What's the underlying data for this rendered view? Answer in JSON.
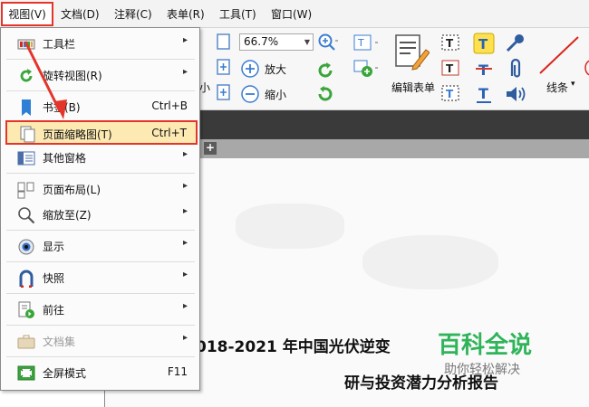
{
  "menubar": {
    "items": [
      "视图(V)",
      "文档(D)",
      "注释(C)",
      "表单(R)",
      "工具(T)",
      "窗口(W)"
    ]
  },
  "ribbon": {
    "zoom_value": "66.7%",
    "zoom_in_label": "放大",
    "zoom_out_label": "缩小",
    "edit_form_label": "编辑表单",
    "lines_label": "线条",
    "partial_label": "小"
  },
  "view_menu": {
    "items": [
      {
        "label": "工具栏",
        "shortcut": "",
        "submenu": true
      },
      {
        "label": "旋转视图(R)",
        "shortcut": "",
        "submenu": true
      },
      {
        "label": "书签(B)",
        "shortcut": "Ctrl+B",
        "submenu": false
      },
      {
        "label": "页面缩略图(T)",
        "shortcut": "Ctrl+T",
        "submenu": false
      },
      {
        "label": "其他窗格",
        "shortcut": "",
        "submenu": true
      },
      {
        "label": "页面布局(L)",
        "shortcut": "",
        "submenu": true
      },
      {
        "label": "缩放至(Z)",
        "shortcut": "",
        "submenu": true
      },
      {
        "label": "显示",
        "shortcut": "",
        "submenu": true
      },
      {
        "label": "快照",
        "shortcut": "",
        "submenu": true
      },
      {
        "label": "前往",
        "shortcut": "",
        "submenu": true
      },
      {
        "label": "文档集",
        "shortcut": "",
        "submenu": true
      },
      {
        "label": "全屏模式",
        "shortcut": "F11",
        "submenu": false
      }
    ],
    "submenu_arrow": "▸"
  },
  "document": {
    "title_line": "018-2021 年中国光伏逆变",
    "subtitle_line": "研与投资潜力分析报告"
  },
  "watermark": {
    "title": "百科全说",
    "subtitle": "助你轻松解决"
  },
  "colors": {
    "highlight_border": "#e4352b",
    "highlight_fill": "#fdeab3",
    "watermark_green": "#2fb45a"
  }
}
